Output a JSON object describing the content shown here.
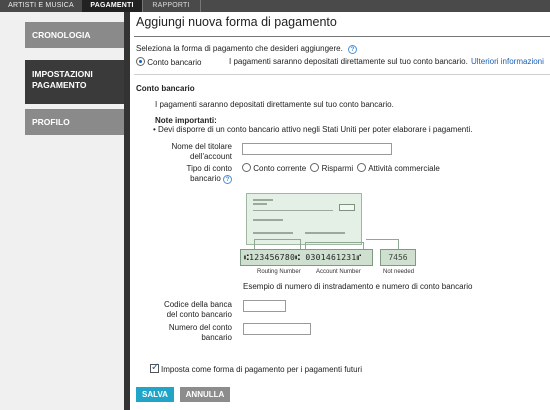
{
  "tabs": [
    {
      "label": "ARTISTI E MUSICA"
    },
    {
      "label": "PAGAMENTI"
    },
    {
      "label": "RAPPORTI"
    }
  ],
  "sidebar": {
    "items": [
      {
        "label": "CRONOLOGIA"
      },
      {
        "label_line1": "IMPOSTAZIONI",
        "label_line2": "PAGAMENTO"
      },
      {
        "label": "PROFILO"
      }
    ]
  },
  "main": {
    "title": "Aggiungi nuova forma di pagamento",
    "select_prompt": "Seleziona la forma di pagamento che desideri aggiungere.",
    "help_glyph": "?",
    "method_option": "Conto bancario",
    "method_desc": "I pagamenti saranno depositati direttamente sul tuo conto bancario.",
    "more_info": "Ulteriori informazioni",
    "section_title": "Conto bancario",
    "section_desc": "I pagamenti saranno depositati direttamente sul tuo conto bancario.",
    "notes_title": "Note importanti:",
    "notes_bullet": "Devi disporre di un conto bancario attivo negli Stati Uniti per poter elaborare i pagamenti."
  },
  "form": {
    "holder_label_1": "Nome del titolare",
    "holder_label_2": "dell'account",
    "holder_value": "",
    "type_label_1": "Tipo di conto",
    "type_label_2": "bancario",
    "type_options": [
      "Conto corrente",
      "Risparmi",
      "Attività commerciale"
    ],
    "check_caption": "Esempio di numero di instradamento e numero di conto bancario",
    "routing_digits": "⑆123456780⑆",
    "account_digits": "0301461231⑈",
    "check_number_digits": "7456",
    "routing_label": "Routing Number",
    "account_label": "Account Number",
    "notneeded_label": "Not needed",
    "bank_code_label_1": "Codice della banca",
    "bank_code_label_2": "del conto bancario",
    "bank_code_value": "",
    "account_number_label_1": "Numero del conto",
    "account_number_label_2": "bancario",
    "account_number_value": "",
    "default_checkbox_label": "Imposta come forma di pagamento per i pagamenti futuri",
    "default_checked": true
  },
  "buttons": {
    "save": "SALVA",
    "cancel": "ANNULLA"
  },
  "colors": {
    "topbar": "#4a4a4a",
    "active_tab": "#222222",
    "sidebar_active": "#3a3a3a",
    "sidebar_inactive": "#8a8a8a",
    "link": "#1a5fb4",
    "save_button": "#20a4c8",
    "cancel_button": "#8c8c8c"
  }
}
